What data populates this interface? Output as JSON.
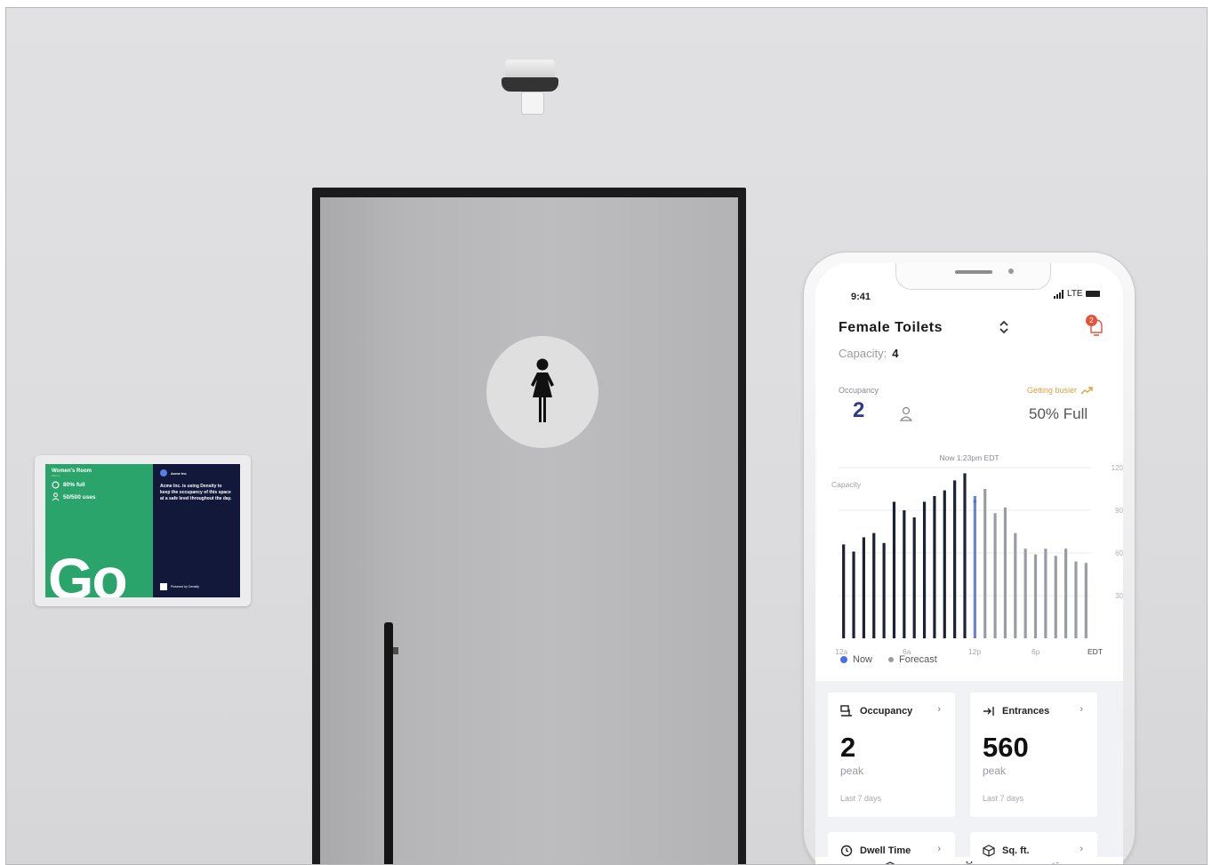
{
  "wall_display": {
    "title": "Women's Room",
    "subtitle": "Floor 1",
    "percent_full": "80% full",
    "uses": "50/500 uses",
    "big_status": "Go",
    "brand": "Acme Inc",
    "message": "Acme Inc. is using Density to keep the occupancy of this space at a safe level throughout the day.",
    "powered_by": "Powered by Density"
  },
  "phone": {
    "status": {
      "time": "9:41",
      "network": "LTE"
    },
    "header": {
      "title": "Female Toilets",
      "capacity_label": "Capacity:",
      "capacity_value": "4",
      "notification_count": "2"
    },
    "occupancy": {
      "label": "Occupancy",
      "value": "2",
      "trend_label": "Getting busier",
      "full_label": "50% Full"
    },
    "chart_data": {
      "type": "bar",
      "annotation": "Now 1:23pm EDT",
      "ylabel": "Capacity",
      "y_ticks": [
        "120",
        "90",
        "60",
        "30"
      ],
      "x_ticks": [
        "12a",
        "6a",
        "12p",
        "6p",
        "EDT"
      ],
      "ylim": [
        0,
        120
      ],
      "now_index": 12,
      "series": [
        {
          "name": "Now",
          "color": "#1b2236",
          "values": [
            66,
            61,
            71,
            74,
            67,
            96,
            90,
            85,
            96,
            100,
            104,
            111,
            116
          ]
        },
        {
          "name": "Forecast",
          "color": "#9a9ca4",
          "values": [
            100,
            105,
            88,
            92,
            74,
            63,
            59,
            63,
            58,
            63,
            54,
            53
          ]
        }
      ]
    },
    "legend": {
      "now": "Now",
      "forecast": "Forecast"
    },
    "cards": [
      {
        "title": "Occupancy",
        "value": "2",
        "label": "peak",
        "sub": "Last 7 days"
      },
      {
        "title": "Entrances",
        "value": "560",
        "label": "peak",
        "sub": "Last 7 days"
      },
      {
        "title": "Dwell Time"
      },
      {
        "title": "Sq. ft."
      }
    ]
  }
}
